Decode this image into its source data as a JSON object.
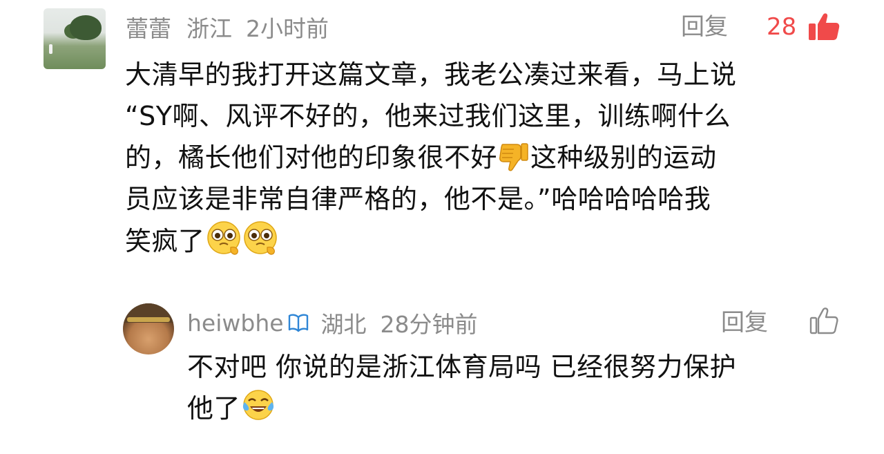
{
  "comment": {
    "user_name": "蕾蕾",
    "location": "浙江",
    "time": "2小时前",
    "reply_label": "回复",
    "like_count": "28",
    "liked": true,
    "accent_color": "#f04a4a",
    "avatar_icon": "landscape-photo-avatar",
    "text_lines": [
      "大清早的我打开这篇文章，我老公凑过来看，马上说",
      "“SY啊、风评不好的，他来过我们这里，训练啊什么",
      "的，橘长他们对他的印象很不好",
      "这种级别的运动",
      "员应该是非常自律严格的，他不是。”哈哈哈哈哈我",
      "笑疯了"
    ],
    "emojis": [
      "thumbs-down-icon",
      "pleading-face-icon",
      "pleading-face-icon"
    ]
  },
  "reply": {
    "user_name": "heiwbhe",
    "verified_icon": "book-icon",
    "location": "湖北",
    "time": "28分钟前",
    "reply_label": "回复",
    "liked": false,
    "avatar_icon": "cartoon-character-avatar",
    "text_lines": [
      "不对吧 你说的是浙江体育局吗 已经很努力保护",
      "他了"
    ],
    "emojis": [
      "tears-of-joy-icon"
    ]
  }
}
